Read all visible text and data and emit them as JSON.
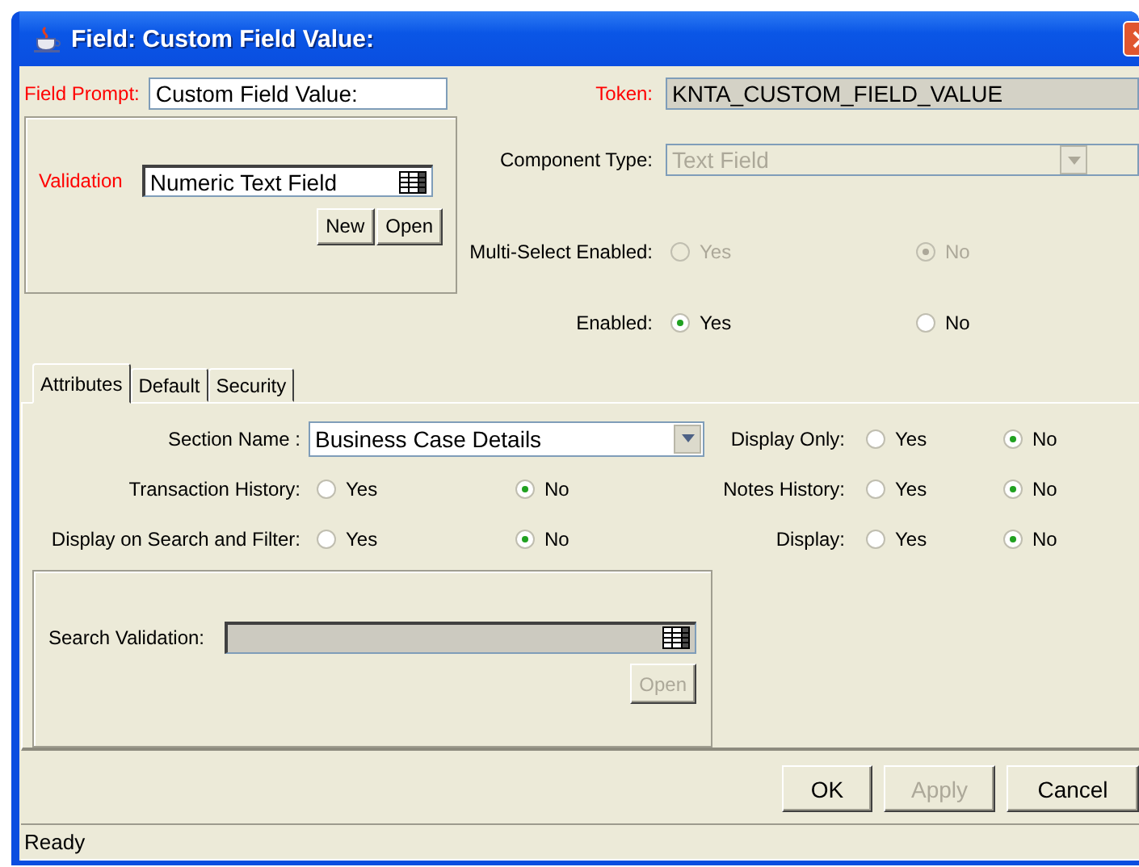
{
  "window": {
    "title": "Field: Custom Field Value:"
  },
  "field_prompt": {
    "label": "Field Prompt:",
    "value": "Custom Field Value:"
  },
  "token": {
    "label": "Token:",
    "value": "KNTA_CUSTOM_FIELD_VALUE"
  },
  "validation": {
    "label": "Validation",
    "value": "Numeric Text Field",
    "buttons": [
      {
        "label": "New",
        "disabled": false
      },
      {
        "label": "Open",
        "disabled": false
      }
    ]
  },
  "component_type": {
    "label": "Component Type:",
    "value": "Text Field",
    "disabled": true
  },
  "top_options": [
    {
      "label": "Multi-Select Enabled:",
      "disabled": true,
      "options": [
        {
          "label": "Yes",
          "selected": false
        },
        {
          "label": "No",
          "selected": true
        }
      ]
    },
    {
      "label": "Enabled:",
      "disabled": false,
      "options": [
        {
          "label": "Yes",
          "selected": true
        },
        {
          "label": "No",
          "selected": false
        }
      ]
    }
  ],
  "tabs": [
    {
      "label": "Attributes",
      "selected": true
    },
    {
      "label": "Default",
      "selected": false
    },
    {
      "label": "Security",
      "selected": false
    }
  ],
  "attribute_rows": [
    [
      {
        "kind": "select",
        "label": "Section Name :",
        "value": "Business Case Details"
      },
      {
        "kind": "radio",
        "label": "Display Only:",
        "options": [
          {
            "label": "Yes",
            "selected": false
          },
          {
            "label": "No",
            "selected": true
          }
        ]
      }
    ],
    [
      {
        "kind": "radio",
        "label": "Transaction History:",
        "options": [
          {
            "label": "Yes",
            "selected": false
          },
          {
            "label": "No",
            "selected": true
          }
        ]
      },
      {
        "kind": "radio",
        "label": "Notes History:",
        "options": [
          {
            "label": "Yes",
            "selected": false
          },
          {
            "label": "No",
            "selected": true
          }
        ]
      }
    ],
    [
      {
        "kind": "radio",
        "label": "Display on Search and Filter:",
        "options": [
          {
            "label": "Yes",
            "selected": false
          },
          {
            "label": "No",
            "selected": true
          }
        ]
      },
      {
        "kind": "radio",
        "label": "Display:",
        "options": [
          {
            "label": "Yes",
            "selected": false
          },
          {
            "label": "No",
            "selected": true
          }
        ]
      }
    ]
  ],
  "search_validation": {
    "label": "Search Validation:",
    "disabled": true,
    "button": {
      "label": "Open",
      "disabled": true
    }
  },
  "footer_buttons": [
    {
      "label": "OK",
      "disabled": false
    },
    {
      "label": "Apply",
      "disabled": true
    },
    {
      "label": "Cancel",
      "disabled": false
    }
  ],
  "status_bar": {
    "text": "Ready"
  }
}
